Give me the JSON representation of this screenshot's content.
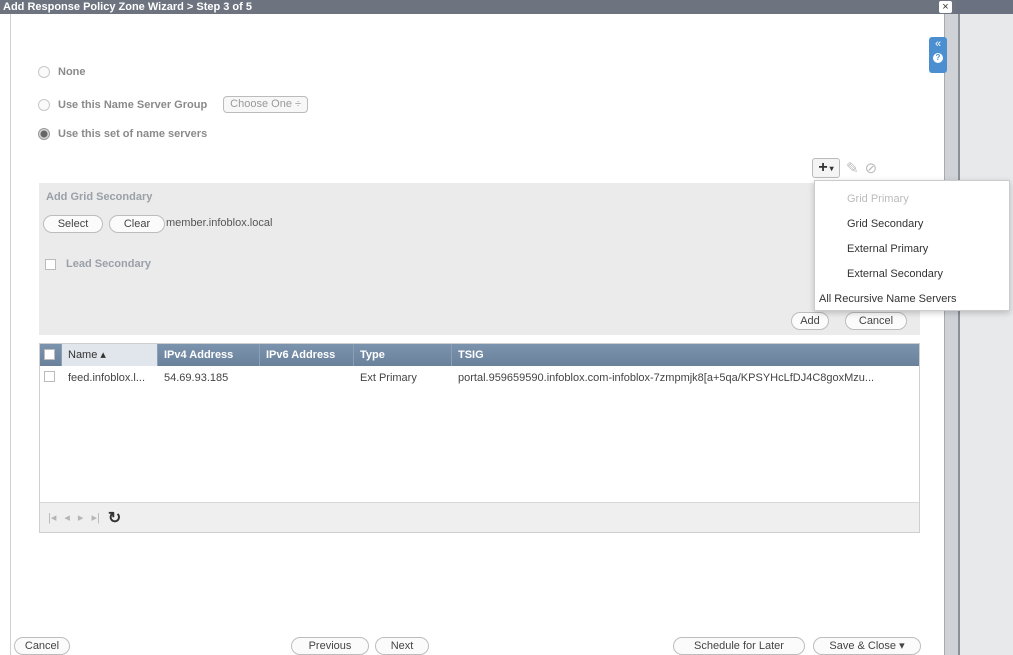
{
  "window": {
    "title": "Add Response Policy Zone Wizard > Step 3 of 5",
    "close_label": "×"
  },
  "side": {
    "collapse_label": "«",
    "help_label": "?"
  },
  "options": {
    "none_label": "None",
    "nsgroup_label": "Use this Name Server Group",
    "nsgroup_select": "Choose One ÷",
    "set_label": "Use this set of name servers"
  },
  "toolbar": {
    "add_icon": "+",
    "caret": "▾",
    "edit_icon": "✎",
    "delete_icon": "⊘"
  },
  "add_grid_secondary": {
    "title": "Add Grid Secondary",
    "select_label": "Select",
    "clear_label": "Clear",
    "member": "member.infoblox.local",
    "lead_secondary_label": "Lead Secondary",
    "add_label": "Add",
    "cancel_label": "Cancel"
  },
  "menu": {
    "items": [
      "Grid Primary",
      "Grid Secondary",
      "External Primary",
      "External Secondary",
      "All Recursive Name Servers"
    ]
  },
  "table": {
    "columns": [
      "Name ▴",
      "IPv4 Address",
      "IPv6 Address",
      "Type",
      "TSIG"
    ],
    "rows": [
      {
        "name": "feed.infoblox.l...",
        "ipv4": "54.69.93.185",
        "ipv6": "",
        "type": "Ext Primary",
        "tsig": "portal.959659590.infoblox.com-infoblox-7zmpmjk8[a+5qa/KPSYHcLfDJ4C8goxMzu..."
      }
    ],
    "pager": {
      "first": "|◂",
      "prev": "◂",
      "next": "▸",
      "last": "▸|",
      "refresh": "↻"
    }
  },
  "footer": {
    "cancel": "Cancel",
    "previous": "Previous",
    "next": "Next",
    "schedule": "Schedule for Later",
    "save_close": "Save & Close ▾"
  }
}
